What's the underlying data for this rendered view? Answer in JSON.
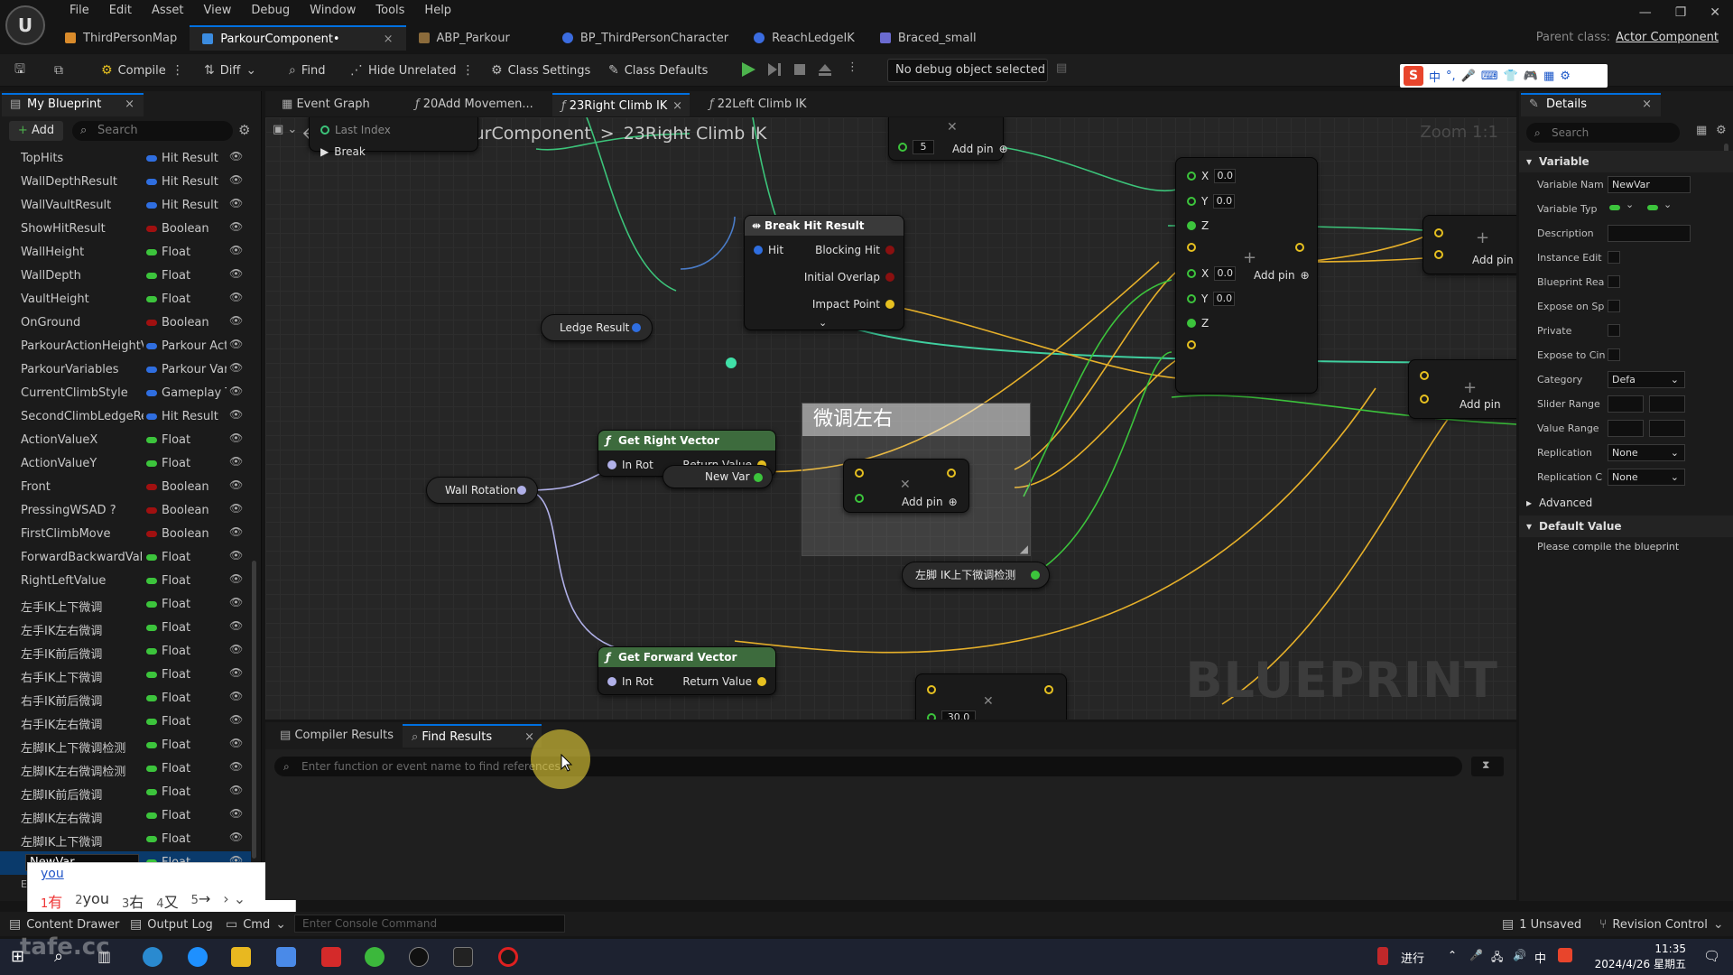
{
  "menu": [
    "File",
    "Edit",
    "Asset",
    "View",
    "Debug",
    "Window",
    "Tools",
    "Help"
  ],
  "doc_tabs": [
    {
      "label": "ThirdPersonMap",
      "color": "#d98b2b"
    },
    {
      "label": "ParkourComponent•",
      "color": "#3b8ce0",
      "active": true,
      "close": "×"
    },
    {
      "label": "ABP_Parkour",
      "color": "#8b6b3b"
    },
    {
      "label": "BP_ThirdPersonCharacter",
      "color": "#3b6ce0"
    },
    {
      "label": "ReachLedgeIK",
      "color": "#3b6ce0"
    },
    {
      "label": "Braced_small",
      "color": "#6b6bd0"
    }
  ],
  "parent_class": {
    "label": "Parent class:",
    "value": "Actor Component"
  },
  "toolbar": {
    "compile": "Compile",
    "diff": "Diff",
    "find": "Find",
    "hide_unrelated": "Hide Unrelated",
    "class_settings": "Class Settings",
    "class_defaults": "Class Defaults",
    "debug_object": "No debug object selected"
  },
  "ime_bar": {
    "logo": "S",
    "items": [
      "中",
      "°,",
      "🎤",
      "⌨",
      "👕",
      "🎮",
      "▦",
      "⚙"
    ]
  },
  "left_panel": {
    "tab_title": "My Blueprint",
    "add_label": "Add",
    "search_placeholder": "Search",
    "variables": [
      {
        "name": "TopHits",
        "type": "Hit Result",
        "color": "#2f6ee0"
      },
      {
        "name": "WallDepthResult",
        "type": "Hit Result",
        "color": "#2f6ee0"
      },
      {
        "name": "WallVaultResult",
        "type": "Hit Result",
        "color": "#2f6ee0"
      },
      {
        "name": "ShowHitResult",
        "type": "Boolean",
        "color": "#a01010"
      },
      {
        "name": "WallHeight",
        "type": "Float",
        "color": "#3cc43c"
      },
      {
        "name": "WallDepth",
        "type": "Float",
        "color": "#3cc43c"
      },
      {
        "name": "VaultHeight",
        "type": "Float",
        "color": "#3cc43c"
      },
      {
        "name": "OnGround",
        "type": "Boolean",
        "color": "#a01010"
      },
      {
        "name": "ParkourActionHeightVa",
        "type": "Parkour Act",
        "color": "#2f6ee0"
      },
      {
        "name": "ParkourVariables",
        "type": "Parkour Var",
        "color": "#2f6ee0"
      },
      {
        "name": "CurrentClimbStyle",
        "type": "Gameplay T",
        "color": "#2f6ee0"
      },
      {
        "name": "SecondClimbLedgeRes",
        "type": "Hit Result",
        "color": "#2f6ee0"
      },
      {
        "name": "ActionValueX",
        "type": "Float",
        "color": "#3cc43c"
      },
      {
        "name": "ActionValueY",
        "type": "Float",
        "color": "#3cc43c"
      },
      {
        "name": "Front",
        "type": "Boolean",
        "color": "#a01010"
      },
      {
        "name": "PressingWSAD ?",
        "type": "Boolean",
        "color": "#a01010"
      },
      {
        "name": "FirstClimbMove",
        "type": "Boolean",
        "color": "#a01010"
      },
      {
        "name": "ForwardBackwardValu",
        "type": "Float",
        "color": "#3cc43c"
      },
      {
        "name": "RightLeftValue",
        "type": "Float",
        "color": "#3cc43c"
      },
      {
        "name": "左手IK上下微调",
        "type": "Float",
        "color": "#3cc43c"
      },
      {
        "name": "左手IK左右微调",
        "type": "Float",
        "color": "#3cc43c"
      },
      {
        "name": "左手IK前后微调",
        "type": "Float",
        "color": "#3cc43c"
      },
      {
        "name": "右手IK上下微调",
        "type": "Float",
        "color": "#3cc43c"
      },
      {
        "name": "右手IK前后微调",
        "type": "Float",
        "color": "#3cc43c"
      },
      {
        "name": "右手IK左右微调",
        "type": "Float",
        "color": "#3cc43c"
      },
      {
        "name": "左脚IK上下微调检测",
        "type": "Float",
        "color": "#3cc43c"
      },
      {
        "name": "左脚IK左右微调检测",
        "type": "Float",
        "color": "#3cc43c"
      },
      {
        "name": "左脚IK前后微调",
        "type": "Float",
        "color": "#3cc43c"
      },
      {
        "name": "左脚IK左右微调",
        "type": "Float",
        "color": "#3cc43c"
      },
      {
        "name": "左脚IK上下微调",
        "type": "Float",
        "color": "#3cc43c"
      },
      {
        "name": "NewVar",
        "type": "Float",
        "color": "#3cc43c",
        "editing": true
      }
    ],
    "footer_stub": "EV"
  },
  "ime_popup": {
    "input": "you",
    "candidates": [
      {
        "n": "1",
        "t": "有"
      },
      {
        "n": "2",
        "t": "you"
      },
      {
        "n": "3",
        "t": "右"
      },
      {
        "n": "4",
        "t": "又"
      },
      {
        "n": "5",
        "t": "→"
      }
    ]
  },
  "graph_tabs": {
    "event_graph": "Event Graph",
    "t1": "20Add Movemen...",
    "t2": "23Right Climb IK",
    "t3": "22Left Climb IK",
    "close": "×"
  },
  "graph": {
    "breadcrumb": [
      "ParkourComponent",
      ">",
      "23Right Climb IK"
    ],
    "zoom": "Zoom 1:1",
    "watermark": "BLUEPRINT",
    "faded_label": "Last Index",
    "break_label": "Break",
    "add_pin": "Add pin",
    "break_hit": {
      "title": "Break Hit Result",
      "hit": "Hit",
      "blocking": "Blocking Hit",
      "overlap": "Initial Overlap",
      "impact": "Impact Point"
    },
    "ledge_result": "Ledge Result",
    "wall_rotation": "Wall Rotation",
    "get_right": {
      "title": "Get Right Vector",
      "in": "In Rot",
      "ret": "Return Value",
      "newvar": "New Var"
    },
    "get_forward": {
      "title": "Get Forward Vector",
      "in": "In Rot",
      "ret": "Return Value"
    },
    "comment": "微调左右",
    "foot_var": "左脚 IK上下微调检测",
    "vec_node": {
      "x1": "X",
      "y1": "Y",
      "z1": "Z",
      "v": "0.0",
      "x2": "X",
      "y2": "Y",
      "z2": "Z"
    },
    "small_val": "5",
    "bottom_val": "30.0"
  },
  "bottom": {
    "compiler_results": "Compiler Results",
    "find_results": "Find Results",
    "close": "×",
    "find_placeholder": "Enter function or event name to find references..."
  },
  "details": {
    "tab_title": "Details",
    "search_placeholder": "Search",
    "variable_section": "Variable",
    "props": [
      {
        "label": "Variable Nam",
        "value": "NewVar",
        "kind": "text"
      },
      {
        "label": "Variable Typ",
        "value": "",
        "kind": "type"
      },
      {
        "label": "Description",
        "value": "",
        "kind": "text"
      },
      {
        "label": "Instance Edit",
        "kind": "check"
      },
      {
        "label": "Blueprint Rea",
        "kind": "check"
      },
      {
        "label": "Expose on Sp",
        "kind": "check"
      },
      {
        "label": "Private",
        "kind": "check"
      },
      {
        "label": "Expose to Cin",
        "kind": "check"
      },
      {
        "label": "Category",
        "value": "Defa",
        "kind": "combo"
      },
      {
        "label": "Slider Range",
        "kind": "range"
      },
      {
        "label": "Value Range",
        "kind": "range"
      },
      {
        "label": "Replication",
        "value": "None",
        "kind": "combo"
      },
      {
        "label": "Replication C",
        "value": "None",
        "kind": "combo"
      }
    ],
    "advanced": "Advanced",
    "default_section": "Default Value",
    "default_note": "Please compile the blueprint"
  },
  "statusbar": {
    "content_drawer": "Content Drawer",
    "output_log": "Output Log",
    "cmd": "Cmd",
    "console_placeholder": "Enter Console Command",
    "unsaved": "1 Unsaved",
    "revision": "Revision Control"
  },
  "taskbar": {
    "tray_text": "进行",
    "ime": "中",
    "time": "11:35",
    "date": "2024/4/26 星期五",
    "watermark": "tafe.cc"
  }
}
